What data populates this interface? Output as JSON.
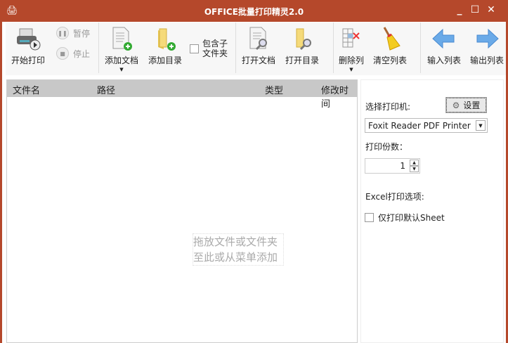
{
  "window": {
    "title": "OFFICE批量打印精灵2.0",
    "minimize": "_",
    "maximize": "☐",
    "close": "✕"
  },
  "toolbar": {
    "start_print": "开始打印",
    "pause": "暂停",
    "stop": "停止",
    "add_doc": "添加文档",
    "add_dir": "添加目录",
    "include_sub": "包含子文件夹",
    "open_doc": "打开文档",
    "open_dir": "打开目录",
    "delete_col": "删除列",
    "clear_list": "清空列表",
    "import_list": "输入列表",
    "export_list": "输出列表"
  },
  "table": {
    "columns": [
      "文件名",
      "路径",
      "类型",
      "修改时间"
    ],
    "drop_hint_1": "拖放文件或文件夹",
    "drop_hint_2": "至此或从菜单添加"
  },
  "panel": {
    "select_printer": "选择打印机:",
    "settings": "设置",
    "printer": "Foxit Reader PDF Printer",
    "copies_label": "打印份数：",
    "copies": "1",
    "excel_options": "Excel打印选项:",
    "default_sheet_only": "仅打印默认Sheet"
  }
}
